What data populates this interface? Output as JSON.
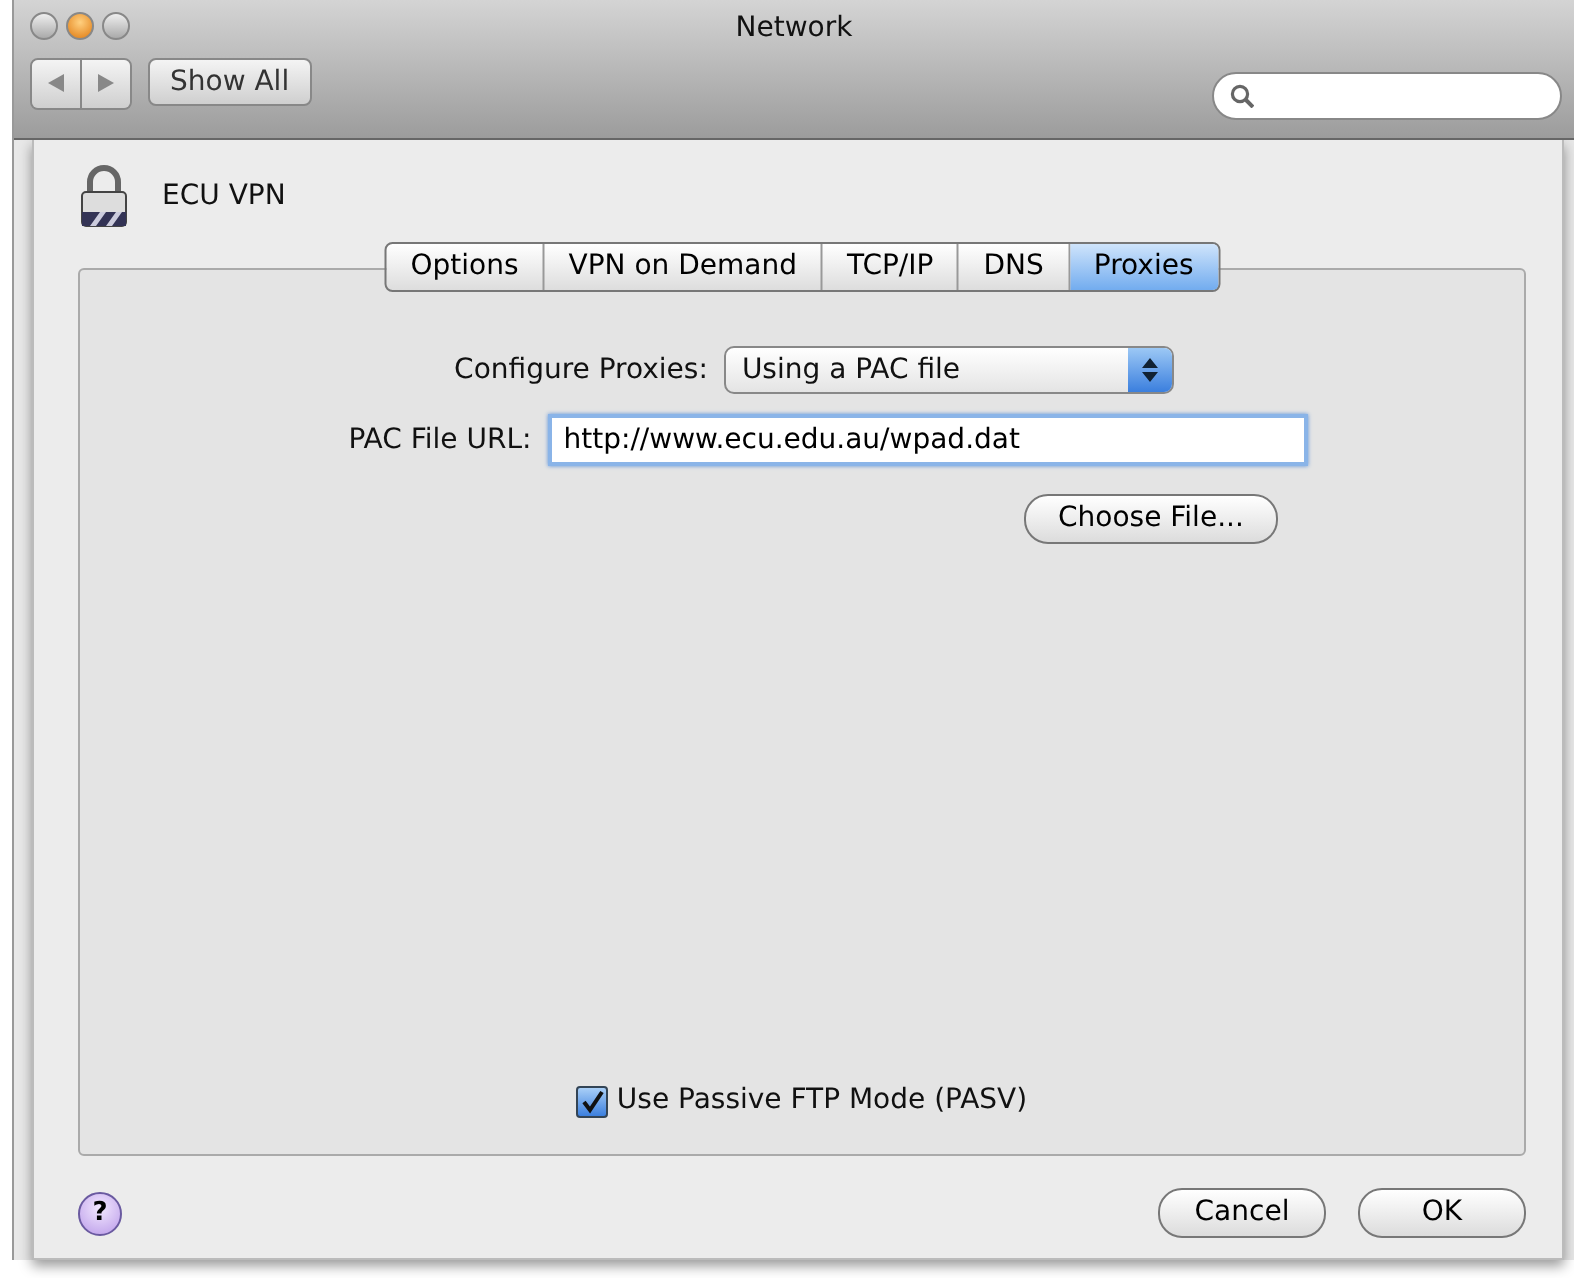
{
  "window": {
    "title": "Network"
  },
  "toolbar": {
    "show_all": "Show All"
  },
  "sheet": {
    "service": "ECU VPN",
    "tabs": [
      {
        "label": "Options",
        "selected": false
      },
      {
        "label": "VPN on Demand",
        "selected": false
      },
      {
        "label": "TCP/IP",
        "selected": false
      },
      {
        "label": "DNS",
        "selected": false
      },
      {
        "label": "Proxies",
        "selected": true
      }
    ],
    "configure_label": "Configure Proxies:",
    "configure_value": "Using a PAC file",
    "url_label": "PAC File URL:",
    "url_value": "http://www.ecu.edu.au/wpad.dat",
    "choose_file": "Choose File...",
    "passive_ftp": {
      "label": "Use Passive FTP Mode (PASV)",
      "checked": true
    },
    "help": "?",
    "buttons": [
      "Cancel",
      "OK"
    ]
  }
}
